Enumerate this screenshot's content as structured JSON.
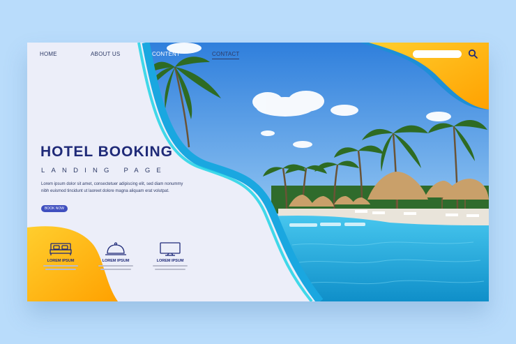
{
  "nav": {
    "items": [
      {
        "label": "HOME"
      },
      {
        "label": "ABOUT US"
      },
      {
        "label": "CONTENT"
      },
      {
        "label": "CONTACT"
      }
    ]
  },
  "hero": {
    "title": "HOTEL BOOKING",
    "subtitle": "LANDING PAGE",
    "description": "Lorem ipsum dolor sit amet, consectetuer adipiscing elit, sed diam nonummy nibh euismod tincidunt ut laoreet dolore magna aliquam erat volutpat.",
    "button_label": "BOOK NOW"
  },
  "features": [
    {
      "title": "LOREM IPSUM",
      "icon": "bed-icon"
    },
    {
      "title": "LOREM IPSUM",
      "icon": "room-service-icon"
    },
    {
      "title": "LOREM IPSUM",
      "icon": "tv-icon"
    }
  ],
  "search": {
    "icon": "search-icon"
  },
  "colors": {
    "navy": "#1f2a78",
    "accent_blue": "#3f4fbf",
    "orange": "#ffb300",
    "cyan": "#1aa7e0",
    "background": "#b9dcfb"
  }
}
